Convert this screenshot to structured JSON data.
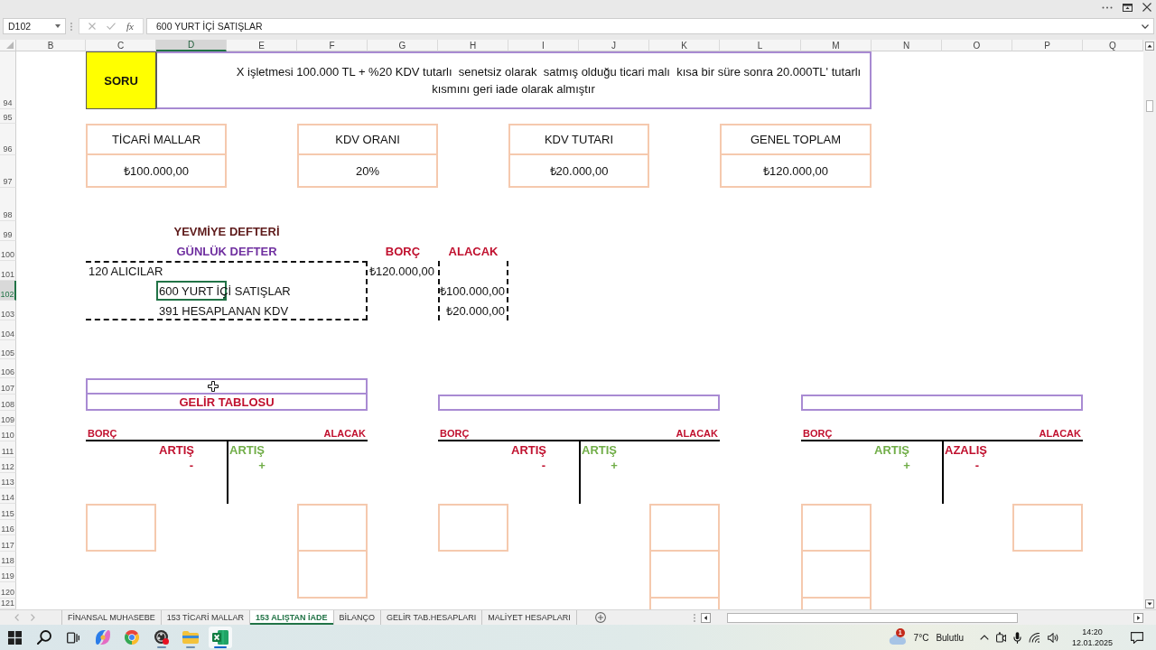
{
  "formula_bar": {
    "name_box": "D102",
    "function_label": "fx",
    "formula": "600 YURT İÇİ SATIŞLAR"
  },
  "columns": [
    {
      "label": "B",
      "selected": false
    },
    {
      "label": "C",
      "selected": false
    },
    {
      "label": "D",
      "selected": true
    },
    {
      "label": "E",
      "selected": false
    },
    {
      "label": "F",
      "selected": false
    },
    {
      "label": "G",
      "selected": false
    },
    {
      "label": "H",
      "selected": false
    },
    {
      "label": "I",
      "selected": false
    },
    {
      "label": "J",
      "selected": false
    },
    {
      "label": "K",
      "selected": false
    },
    {
      "label": "L",
      "selected": false
    },
    {
      "label": "M",
      "selected": false
    },
    {
      "label": "N",
      "selected": false
    },
    {
      "label": "O",
      "selected": false
    },
    {
      "label": "P",
      "selected": false
    },
    {
      "label": "Q",
      "selected": false
    }
  ],
  "rows": [
    {
      "label": "94",
      "selected": false
    },
    {
      "label": "95",
      "selected": false
    },
    {
      "label": "96",
      "selected": false
    },
    {
      "label": "97",
      "selected": false
    },
    {
      "label": "98",
      "selected": false
    },
    {
      "label": "99",
      "selected": false
    },
    {
      "label": "100",
      "selected": false
    },
    {
      "label": "101",
      "selected": false
    },
    {
      "label": "102",
      "selected": true
    },
    {
      "label": "103",
      "selected": false
    },
    {
      "label": "104",
      "selected": false
    },
    {
      "label": "105",
      "selected": false
    },
    {
      "label": "106",
      "selected": false
    },
    {
      "label": "107",
      "selected": false
    },
    {
      "label": "108",
      "selected": false
    },
    {
      "label": "109",
      "selected": false
    },
    {
      "label": "110",
      "selected": false
    },
    {
      "label": "111",
      "selected": false
    },
    {
      "label": "112",
      "selected": false
    },
    {
      "label": "113",
      "selected": false
    },
    {
      "label": "114",
      "selected": false
    },
    {
      "label": "115",
      "selected": false
    },
    {
      "label": "116",
      "selected": false
    },
    {
      "label": "117",
      "selected": false
    },
    {
      "label": "118",
      "selected": false
    },
    {
      "label": "119",
      "selected": false
    },
    {
      "label": "120",
      "selected": false
    },
    {
      "label": "121",
      "selected": false
    }
  ],
  "question": {
    "label": "SORU",
    "text": "X işletmesi 100.000 TL + %20 KDV tutarlı  senetsiz olarak  satmış olduğu ticari malı  kısa bir süre sonra 20.000TL' tutarlı kısmını geri iade olarak almıştır"
  },
  "summary_boxes": [
    {
      "title": "TİCARİ MALLAR",
      "value": "₺100.000,00"
    },
    {
      "title": "KDV ORANI",
      "value": "20%"
    },
    {
      "title": "KDV TUTARI",
      "value": "₺20.000,00"
    },
    {
      "title": "GENEL TOPLAM",
      "value": "₺120.000,00"
    }
  ],
  "journal": {
    "title": "YEVMİYE DEFTERİ",
    "subtitle": "GÜNLÜK DEFTER",
    "debit_header": "BORÇ",
    "credit_header": "ALACAK",
    "entries": [
      {
        "kind": "debit",
        "account": "120 ALICILAR",
        "amount": "₺120.000,00",
        "selected": false
      },
      {
        "kind": "credit",
        "account": "600 YURT İÇİ SATIŞLAR",
        "amount": "₺100.000,00",
        "selected": true
      },
      {
        "kind": "credit",
        "account": "391 HESAPLANAN KDV",
        "amount": "₺20.000,00",
        "selected": false
      }
    ]
  },
  "t_accounts": [
    {
      "kind": "double",
      "title": "GELİR TABLOSU",
      "debit_label": "BORÇ",
      "credit_label": "ALACAK",
      "left": {
        "label": "ARTIŞ",
        "sign": "-",
        "color": "#c0102e"
      },
      "right": {
        "label": "ARTIŞ",
        "sign": "+",
        "color": "#70ad47"
      },
      "left_boxes": [
        {
          "kind": "full"
        }
      ],
      "right_boxes": [
        {
          "kind": "full"
        },
        {
          "kind": "full"
        }
      ]
    },
    {
      "kind": "single",
      "debit_label": "BORÇ",
      "credit_label": "ALACAK",
      "left": {
        "label": "ARTIŞ",
        "sign": "-",
        "color": "#c0102e"
      },
      "right": {
        "label": "ARTIŞ",
        "sign": "+",
        "color": "#70ad47"
      },
      "left_boxes": [
        {
          "kind": "full"
        }
      ],
      "right_boxes": [
        {
          "kind": "full"
        },
        {
          "kind": "full"
        },
        {
          "kind": "cut"
        }
      ]
    },
    {
      "kind": "single",
      "debit_label": "BORÇ",
      "credit_label": "ALACAK",
      "left": {
        "label": "ARTIŞ",
        "sign": "+",
        "color": "#70ad47"
      },
      "right": {
        "label": "AZALIŞ",
        "sign": "-",
        "color": "#c0102e"
      },
      "left_boxes": [
        {
          "kind": "full"
        },
        {
          "kind": "full"
        },
        {
          "kind": "cut"
        }
      ],
      "right_boxes": [
        {
          "kind": "full"
        }
      ]
    }
  ],
  "sheet_tabs": [
    {
      "label": "FİNANSAL MUHASEBE",
      "selected": false
    },
    {
      "label": "153 TİCARİ MALLAR",
      "selected": false
    },
    {
      "label": "153 ALIŞTAN İADE",
      "selected": true
    },
    {
      "label": "BİLANÇO",
      "selected": false
    },
    {
      "label": "GELİR TAB.HESAPLARI",
      "selected": false
    },
    {
      "label": "MALİYET HESAPLARI",
      "selected": false
    }
  ],
  "taskbar": {
    "apps": [
      {
        "kind": "start",
        "running": false,
        "active": false
      },
      {
        "kind": "search",
        "running": false,
        "active": false
      },
      {
        "kind": "taskview",
        "running": false,
        "active": false
      },
      {
        "kind": "copilot",
        "running": false,
        "active": false
      },
      {
        "kind": "browser",
        "running": false,
        "active": false
      },
      {
        "kind": "recorder",
        "running": true,
        "active": false
      },
      {
        "kind": "files",
        "running": true,
        "active": false
      },
      {
        "kind": "spreadsheet",
        "running": true,
        "active": true
      }
    ],
    "weather": {
      "badge": "1",
      "temperature": "7°C",
      "condition": "Bulutlu"
    },
    "clock": {
      "time": "14:20",
      "date": "12.01.2025"
    }
  }
}
